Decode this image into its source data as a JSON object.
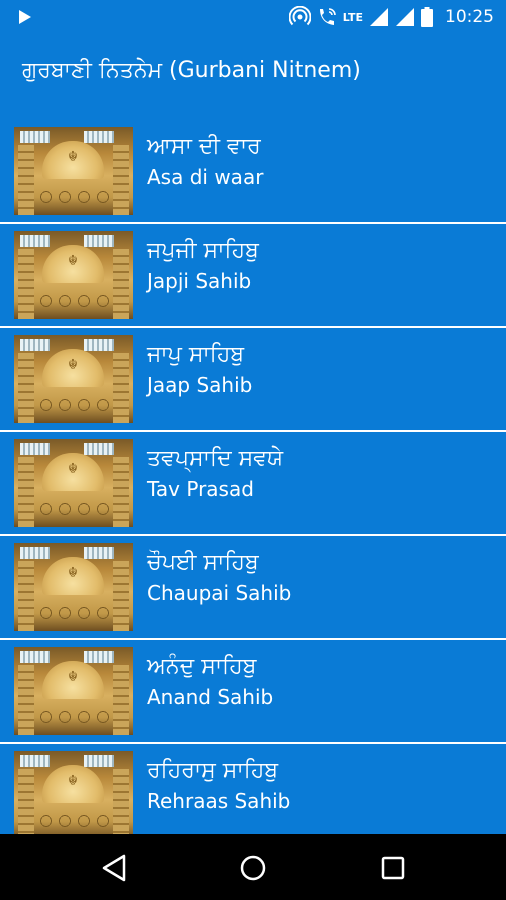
{
  "status_bar": {
    "time": "10:25",
    "network_label": "LTE",
    "network_4g": "4G"
  },
  "app_bar": {
    "title": "ਗੁਰਬਾਣੀ ਨਿਤਨੇਮ (Gurbani Nitnem)"
  },
  "list": {
    "items": [
      {
        "title_pa": "ਆਸਾ ਦੀ ਵਾਰ",
        "title_en": "Asa di waar"
      },
      {
        "title_pa": "ਜਪੁਜੀ ਸਾਹਿਬੁ",
        "title_en": "Japji Sahib"
      },
      {
        "title_pa": "ਜਾਪੁ ਸਾਹਿਬੁ",
        "title_en": "Jaap Sahib"
      },
      {
        "title_pa": "ਤਵਪ੍ਸਾਦਿ ਸਵਯੇ",
        "title_en": "Tav Prasad"
      },
      {
        "title_pa": "ਚੌਪਈ ਸਾਹਿਬੁ",
        "title_en": "Chaupai Sahib"
      },
      {
        "title_pa": "ਅਨੰਦੁ ਸਾਹਿਬੁ",
        "title_en": "Anand Sahib"
      },
      {
        "title_pa": "ਰਹਿਰਾਸੁ ਸਾਹਿਬੁ",
        "title_en": "Rehraas Sahib"
      }
    ]
  },
  "icons": {
    "play": "play-icon",
    "hotspot": "hotspot-icon",
    "wifi_calling": "wifi-call-icon",
    "signal": "signal-icon",
    "battery": "battery-icon",
    "back": "back-icon",
    "home": "home-icon",
    "recents": "recents-icon"
  },
  "colors": {
    "background": "#0a7bd6",
    "divider": "#ffffff",
    "nav_bar": "#000000"
  }
}
